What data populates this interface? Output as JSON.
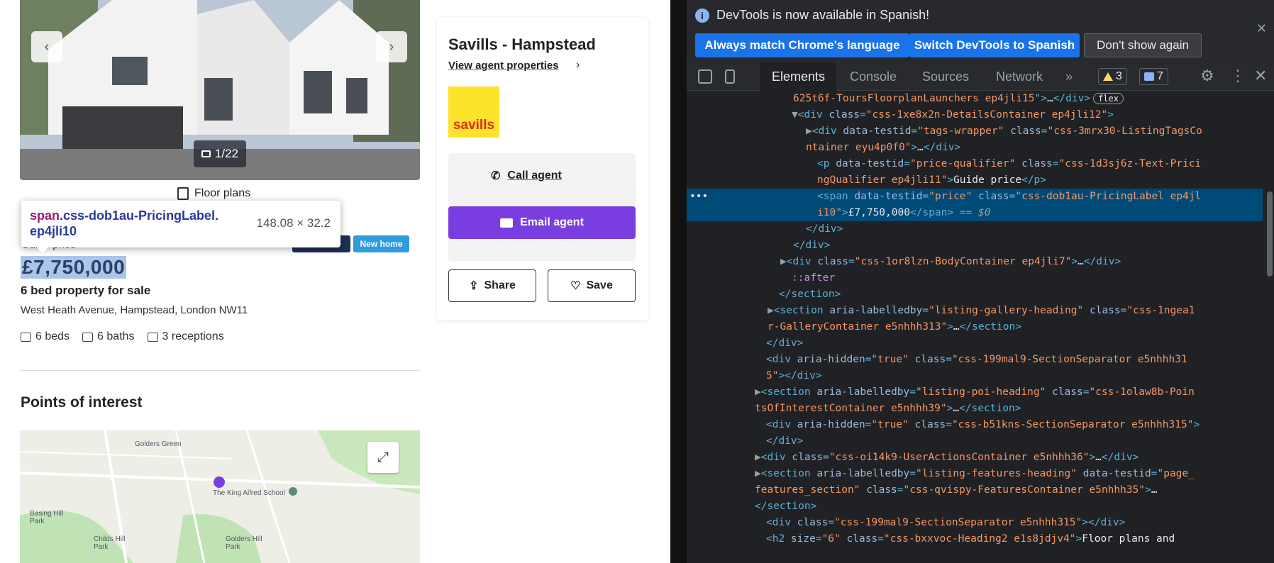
{
  "listing": {
    "photo_count": "1/22",
    "floor_plans_label": "Floor plans",
    "badges": [
      "Featured",
      "New home"
    ],
    "qualifier": "Guide price",
    "price": "£7,750,000",
    "headline": "6 bed property for sale",
    "address": "West Heath Avenue, Hampstead, London NW11",
    "features": [
      "6 beds",
      "6 baths",
      "3 receptions"
    ],
    "poi_heading": "Points of interest",
    "map_labels": [
      "Golders Green",
      "The King Alfred School",
      "Golders Hill Park",
      "Childs Hill Park",
      "Basing Hill Park"
    ]
  },
  "tooltip": {
    "tag": "span",
    "class_text": ".css-dob1au-PricingLabel.",
    "class_text2": "ep4jli10",
    "size": "148.08 × 32.2"
  },
  "agent": {
    "name": "Savills - Hampstead",
    "view_link": "View agent properties",
    "logo_text": "savills",
    "call_label": "Call agent",
    "email_label": "Email agent",
    "share_label": "Share",
    "save_label": "Save"
  },
  "devtools": {
    "info_message": "DevTools is now available in Spanish!",
    "btn_match": "Always match Chrome's language",
    "btn_switch": "Switch DevTools to Spanish",
    "btn_dismiss": "Don't show again",
    "tabs": [
      "Elements",
      "Console",
      "Sources",
      "Network"
    ],
    "more_tabs": "»",
    "warnings": "3",
    "messages": "7"
  },
  "colors": {
    "accent": "#7a3ee0",
    "price_highlight": "#a9c6e8",
    "devtools_bg": "#202124",
    "selected_row": "#004a77"
  }
}
